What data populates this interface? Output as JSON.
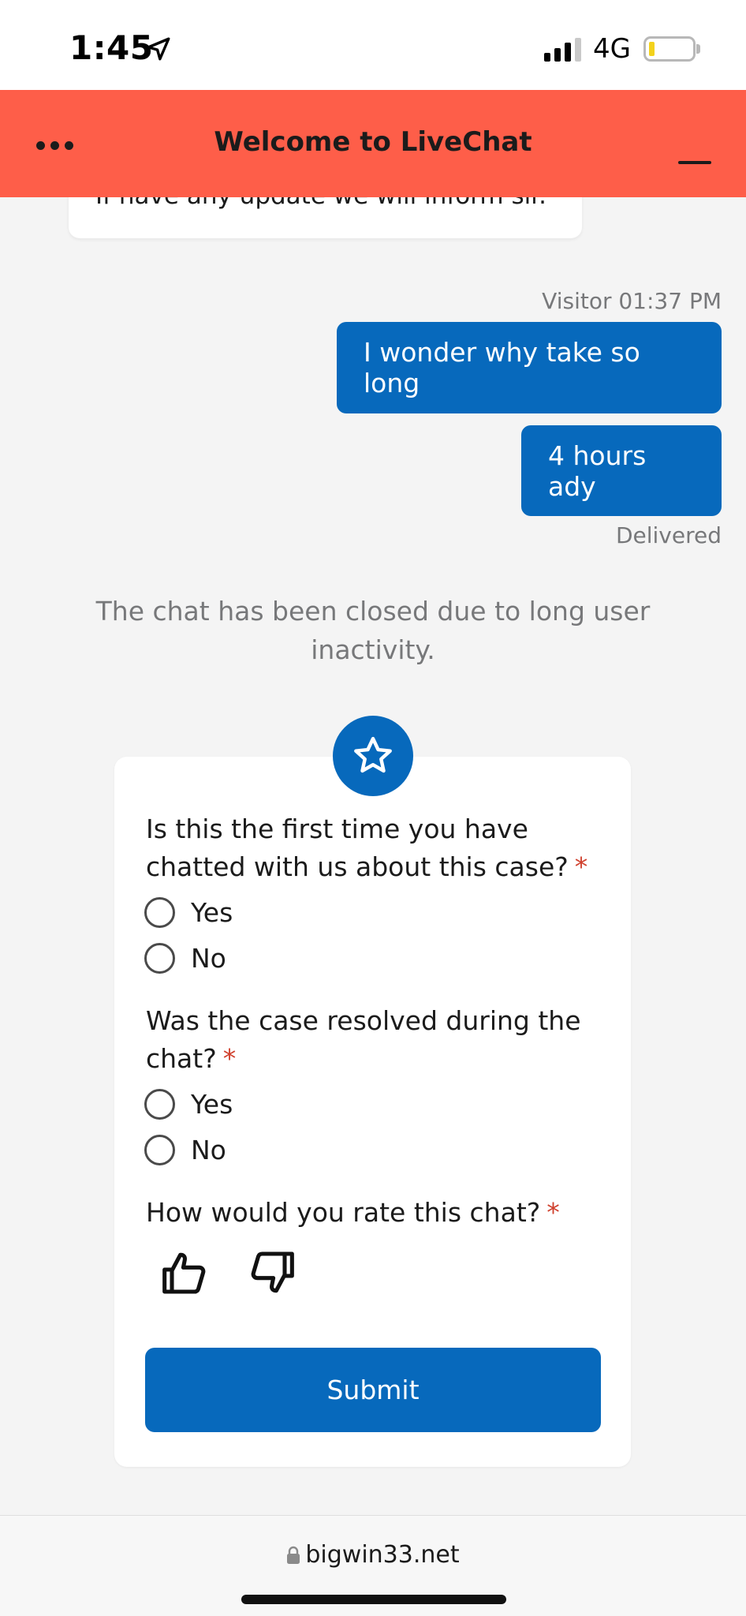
{
  "status_bar": {
    "time": "1:45",
    "network": "4G",
    "location_icon": "location-arrow-icon",
    "signal_icon": "signal-bars-icon",
    "battery_icon": "battery-low-icon"
  },
  "header": {
    "title": "Welcome to LiveChat",
    "menu_icon": "more-dots-icon",
    "minimize_icon": "minimize-icon",
    "background": "#fe5e49"
  },
  "chat": {
    "agent_partial_message": "If have any update we will inform sir.",
    "visitor_meta": "Visitor 01:37 PM",
    "visitor_messages": [
      "I wonder why take so long",
      "4 hours ady"
    ],
    "delivery_status": "Delivered",
    "system_message": "The chat has been closed due to long user inactivity.",
    "accent": "#0769bc"
  },
  "survey": {
    "badge_icon": "star-icon",
    "questions": [
      {
        "label": "Is this the first time you have chatted with us about this case?",
        "required": "*",
        "options": [
          "Yes",
          "No"
        ]
      },
      {
        "label": "Was the case resolved during the chat?",
        "required": "*",
        "options": [
          "Yes",
          "No"
        ]
      },
      {
        "label": "How would you rate this chat?",
        "required": "*",
        "options": [
          "thumbs-up-icon",
          "thumbs-down-icon"
        ]
      }
    ],
    "submit_label": "Submit"
  },
  "browser": {
    "url": "bigwin33.net",
    "lock_icon": "lock-icon"
  }
}
